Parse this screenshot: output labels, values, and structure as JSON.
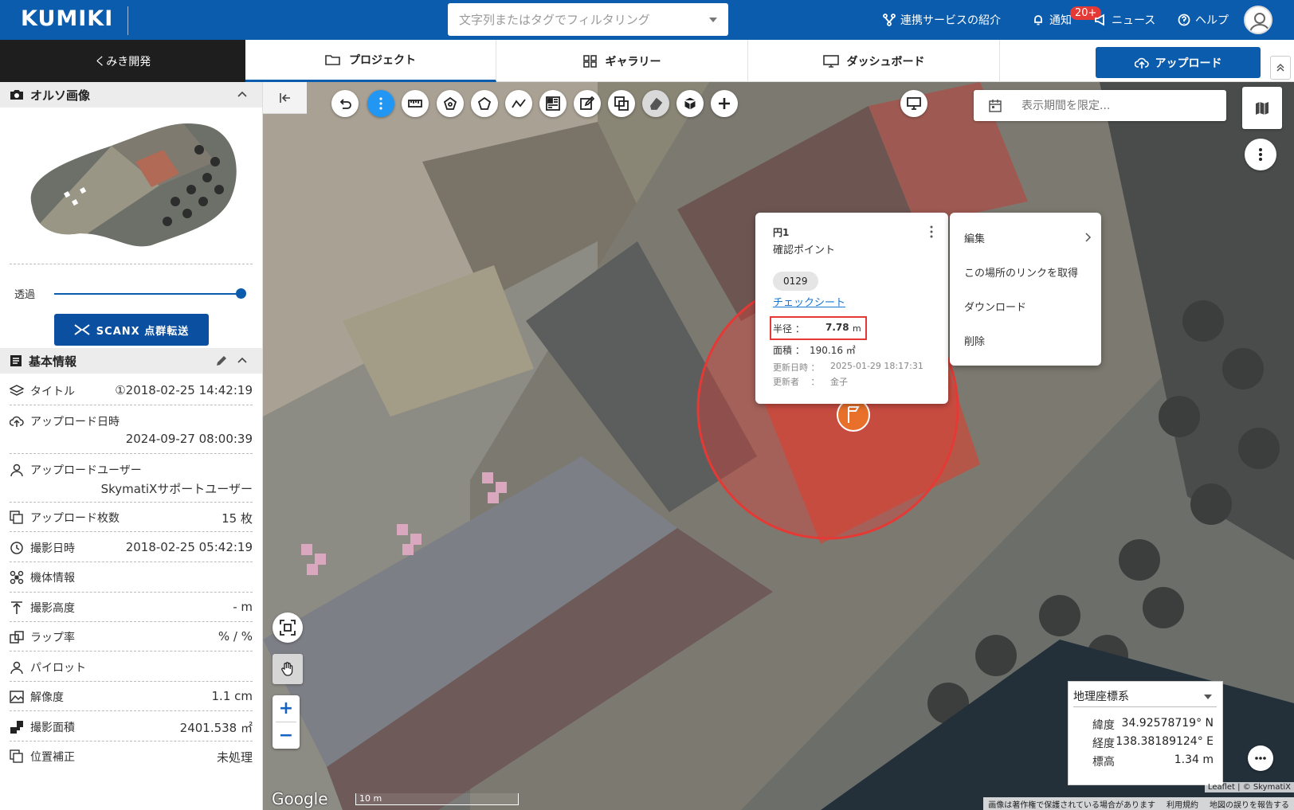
{
  "header": {
    "logo": "KUMIKI",
    "search_placeholder": "文字列またはタグでフィルタリング",
    "nav": {
      "services": "連携サービスの紹介",
      "notify": "通知",
      "notify_badge": "20+",
      "news": "ニュース",
      "help": "ヘルプ"
    }
  },
  "tabs": {
    "project_name": "くみき開発",
    "items": [
      {
        "label": "プロジェクト",
        "icon": "folder-icon"
      },
      {
        "label": "ギャラリー",
        "icon": "grid-icon"
      },
      {
        "label": "ダッシュボード",
        "icon": "monitor-icon"
      }
    ],
    "upload": "アップロード"
  },
  "sidebar": {
    "ortho": {
      "title": "オルソ画像",
      "opacity_label": "透過",
      "opacity_value": 1.0,
      "scanx_button": "SCANX 点群転送"
    },
    "basic": {
      "title": "基本情報",
      "rows": [
        {
          "label": "タイトル",
          "value": "①2018-02-25 14:42:19",
          "icon": "layers-icon"
        },
        {
          "label": "アップロード日時",
          "value": "2024-09-27 08:00:39",
          "icon": "cloud-upload-icon"
        },
        {
          "label": "アップロードユーザー",
          "value": "SkymatiXサポートユーザー",
          "icon": "user-icon"
        },
        {
          "label": "アップロード枚数",
          "value": "15 枚",
          "icon": "images-icon"
        },
        {
          "label": "撮影日時",
          "value": "2018-02-25 05:42:19",
          "icon": "clock-icon"
        },
        {
          "label": "機体情報",
          "value": "",
          "icon": "drone-icon"
        },
        {
          "label": "撮影高度",
          "value": "- m",
          "icon": "altitude-icon"
        },
        {
          "label": "ラップ率",
          "value": "% / %",
          "icon": "overlap-icon"
        },
        {
          "label": "パイロット",
          "value": "",
          "icon": "pilot-icon"
        },
        {
          "label": "解像度",
          "value": "1.1 cm",
          "icon": "resolution-icon"
        },
        {
          "label": "撮影面積",
          "value": "2401.538 ㎡",
          "icon": "area-icon"
        },
        {
          "label": "位置補正",
          "value": "未処理",
          "icon": "position-icon"
        }
      ]
    }
  },
  "map": {
    "date_placeholder": "表示期間を限定...",
    "popup": {
      "title": "円1",
      "subtitle": "確認ポイント",
      "tag": "0129",
      "link": "チェックシート",
      "radius_label": "半径 ：",
      "radius_value": "7.78",
      "radius_unit": "m",
      "area_label": "面積 ：",
      "area_value": "190.16 ㎡",
      "updated_label": "更新日時 ：",
      "updated_value": "2025-01-29 18:17:31",
      "updater_label": "更新者 　：",
      "updater_value": "金子"
    },
    "menu": [
      "編集",
      "この場所のリンクを取得",
      "ダウンロード",
      "削除"
    ],
    "coord": {
      "system": "地理座標系",
      "lat_label": "緯度",
      "lat": "34.92578719° N",
      "lon_label": "経度",
      "lon": "138.38189124° E",
      "alt_label": "標高",
      "alt": "1.34 m"
    },
    "google": "Google",
    "scale": "10 m",
    "attribution": "Leaflet | © SkymatiX",
    "footer": [
      "画像は著作権で保護されている場合があります",
      "利用規約",
      "地図の誤りを報告する"
    ],
    "zoom_in": "+",
    "zoom_out": "−"
  }
}
